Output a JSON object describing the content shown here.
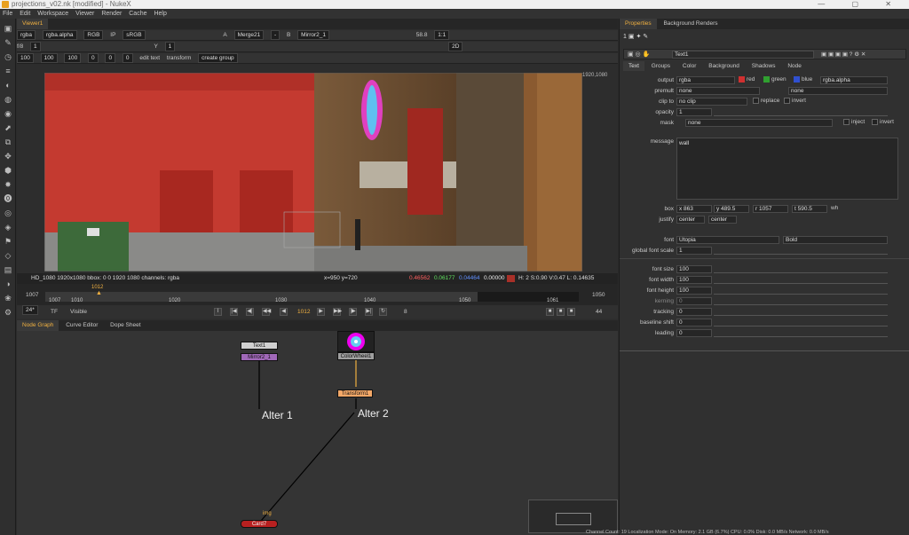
{
  "window": {
    "title": "projections_v02.nk [modified] - NukeX",
    "controls": "— ▢ ✕"
  },
  "menu": [
    "File",
    "Edit",
    "Workspace",
    "Viewer",
    "Render",
    "Cache",
    "Help"
  ],
  "viewer": {
    "tab": "Viewer1",
    "channels": "rgba",
    "alpha": "rgba.alpha",
    "colorspace_mode": "RGB",
    "ip": "IP",
    "lut": "sRGB",
    "input_a": "Merge21",
    "input_a_letter": "A",
    "input_b_letter": "B",
    "input_b": "Mirror2_1",
    "wipe": "-",
    "zoom": "58.8",
    "ratio": "1:1",
    "mode": "2D",
    "fstop": "f/8",
    "frame_field": "1",
    "y_label": "Y",
    "y_field": "1",
    "text_tools": {
      "t1": "100",
      "t2": "100",
      "t3": "100",
      "av": "0",
      "aw": "0",
      "rot": "0",
      "edit_text": "edit text",
      "transform": "transform",
      "create_group": "create group"
    },
    "format_corner": "1920,1080",
    "info_left": "HD_1080 1920x1080  bbox: 0 0 1920 1080 channels: rgba",
    "info_xy": "x=950 y=720",
    "info_r": "0.46562",
    "info_g": "0.06177",
    "info_b": "0.04464",
    "info_a": "0.00000",
    "info_hsv": "H:  2 S:0.90 V:0.47  L: 0.14635",
    "overlay_text": "wall"
  },
  "timeline": {
    "in": "1007",
    "out": "1050",
    "current": "1012",
    "ticks": [
      "1007",
      "1010",
      "1020",
      "1030",
      "1040",
      "1050"
    ],
    "end_label": "1061",
    "fps": "24*",
    "tf": "TF",
    "visible": "Visible",
    "frame": "1012",
    "step": "8",
    "step2": "44"
  },
  "nodegraph": {
    "tabs": [
      "Node Graph",
      "Curve Editor",
      "Dope Sheet"
    ],
    "nodes": {
      "text1": "Text1",
      "mirror": "Mirror2_1",
      "colorwheel": "ColorWheel1",
      "transform": "Transform1",
      "card": "Card7",
      "img": "img"
    },
    "labels": {
      "alter1": "Alter 1",
      "alter2": "Alter 2"
    }
  },
  "properties": {
    "tabs": [
      "Properties",
      "Background Renders"
    ],
    "node_name": "Text1",
    "subtabs": [
      "Text",
      "Groups",
      "Color",
      "Background",
      "Shadows",
      "Node"
    ],
    "output": {
      "label": "output",
      "value": "rgba",
      "red": "red",
      "green": "green",
      "blue": "blue",
      "alpha": "rgba.alpha"
    },
    "premult": {
      "label": "premult",
      "value": "none",
      "value2": "none"
    },
    "clipto": {
      "label": "clip to",
      "value": "no clip",
      "replace": "replace",
      "invert": "invert"
    },
    "opacity": {
      "label": "opacity",
      "value": "1"
    },
    "mask": {
      "label": "mask",
      "value": "none",
      "inject": "inject",
      "invert": "invert"
    },
    "message": {
      "label": "message",
      "value": "wall"
    },
    "box": {
      "label": "box",
      "x": "x 863",
      "y": "y 489.5",
      "r": "r 1057",
      "t": "t 590.5",
      "wh": "wh"
    },
    "justify": {
      "label": "justify",
      "h": "center",
      "v": "center"
    },
    "font": {
      "label": "font",
      "family": "Utopia",
      "style": "Bold"
    },
    "global_scale": {
      "label": "global font scale",
      "value": "1"
    },
    "rows": [
      {
        "label": "font size",
        "value": "100"
      },
      {
        "label": "font width",
        "value": "100"
      },
      {
        "label": "font height",
        "value": "100"
      },
      {
        "label": "kerning",
        "value": "0"
      },
      {
        "label": "tracking",
        "value": "0"
      },
      {
        "label": "baseline shift",
        "value": "0"
      },
      {
        "label": "leading",
        "value": "0"
      }
    ]
  },
  "status": "Channel Count: 19  Localization Mode: On  Memory: 2.1 GB (6.7%)  CPU: 0.0%  Disk: 0.0 MB/s  Network: 0.0 MB/s",
  "colors": {
    "accent": "#f0b040",
    "node_text": "#c8c8c8",
    "mirror": "#a068b8",
    "transform": "#f4a868",
    "card": "#b82020"
  }
}
